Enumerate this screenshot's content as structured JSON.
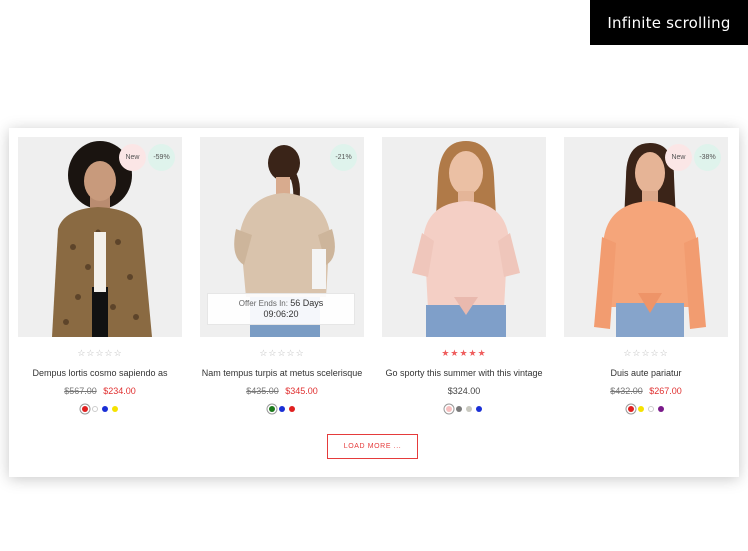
{
  "banner": {
    "label": "Infinite scrolling"
  },
  "products": [
    {
      "badges": {
        "new": "New",
        "sale": "-59%"
      },
      "rating": "☆☆☆☆☆",
      "title": "Dempus lortis cosmo sapiendo as",
      "old_price": "$567.00",
      "price": "$234.00",
      "swatches": [
        "#e02020",
        "#ffffff",
        "#1a2fd6",
        "#f5e200"
      ]
    },
    {
      "badges": {
        "sale": "-21%"
      },
      "countdown": {
        "label": "Offer Ends In:",
        "days": "56 Days",
        "time": "09:06:20"
      },
      "rating": "☆☆☆☆☆",
      "title": "Nam tempus turpis at metus scelerisque",
      "old_price": "$435.00",
      "price": "$345.00",
      "swatches": [
        "#1b7a1b",
        "#1a2fd6",
        "#e02020"
      ]
    },
    {
      "rating": "★★★★★",
      "title": "Go sporty this summer with this vintage",
      "price": "$324.00",
      "swatches": [
        "#f7c0c0",
        "#7a7a7a",
        "#c9c9c0",
        "#1a2fd6"
      ]
    },
    {
      "badges": {
        "new": "New",
        "sale": "-38%"
      },
      "rating": "☆☆☆☆☆",
      "title": "Duis aute pariatur",
      "old_price": "$432.00",
      "price": "$267.00",
      "swatches": [
        "#e02020",
        "#f5e200",
        "#ffffff",
        "#7a1a8a"
      ]
    }
  ],
  "load_more": {
    "label": "LOAD MORE ..."
  }
}
